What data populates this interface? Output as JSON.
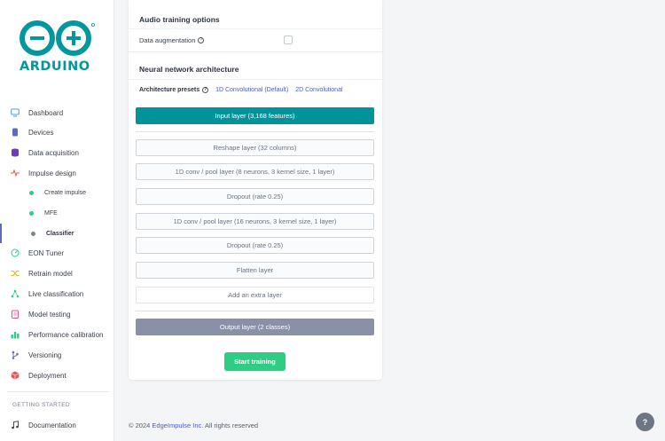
{
  "brand": {
    "name": "ARDUINO",
    "color": "#00979d"
  },
  "sidebar": {
    "items": [
      {
        "label": "Dashboard",
        "icon": "monitor-icon"
      },
      {
        "label": "Devices",
        "icon": "device-icon"
      },
      {
        "label": "Data acquisition",
        "icon": "database-icon"
      },
      {
        "label": "Impulse design",
        "icon": "pulse-icon"
      },
      {
        "label": "Create impulse",
        "sub": true,
        "dot": "#2ecc85"
      },
      {
        "label": "MFE",
        "sub": true,
        "dot": "#2ecc85"
      },
      {
        "label": "Classifier",
        "sub": true,
        "dot": "#7a8596",
        "active": true
      },
      {
        "label": "EON Tuner",
        "icon": "tuner-icon"
      },
      {
        "label": "Retrain model",
        "icon": "shuffle-icon"
      },
      {
        "label": "Live classification",
        "icon": "nodes-icon"
      },
      {
        "label": "Model testing",
        "icon": "clipboard-icon"
      },
      {
        "label": "Performance calibration",
        "icon": "bar-chart-icon"
      },
      {
        "label": "Versioning",
        "icon": "branch-icon"
      },
      {
        "label": "Deployment",
        "icon": "package-icon"
      }
    ],
    "section_header": "GETTING STARTED",
    "documentation": "Documentation"
  },
  "main": {
    "audio_options_title": "Audio training options",
    "data_augmentation_label": "Data augmentation",
    "nn_title": "Neural network architecture",
    "presets_label": "Architecture presets",
    "presets": [
      "1D Convolutional (Default)",
      "2D Convolutional"
    ],
    "input_layer": "Input layer (3,168 features)",
    "layers": [
      "Reshape layer (32 columns)",
      "1D conv / pool layer (8 neurons, 3 kernel size, 1 layer)",
      "Dropout (rate 0.25)",
      "1D conv / pool layer (16 neurons, 3 kernel size, 1 layer)",
      "Dropout (rate 0.25)",
      "Flatten layer"
    ],
    "add_layer": "Add an extra layer",
    "output_layer": "Output layer (2 classes)",
    "start_training": "Start training"
  },
  "footer": {
    "copyright": "© 2024",
    "company": "EdgeImpulse Inc.",
    "rights": "All rights reserved"
  },
  "help_fab": "?"
}
